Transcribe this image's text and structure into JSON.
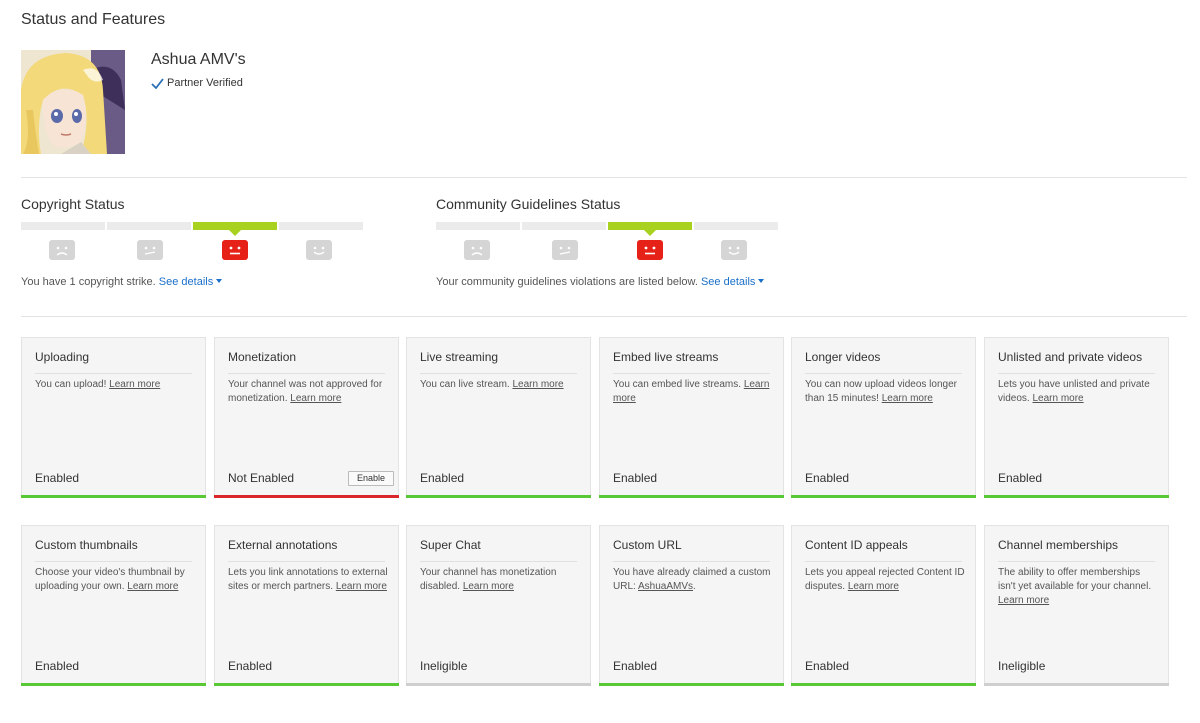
{
  "page": {
    "title": "Status and Features"
  },
  "channel": {
    "name": "Ashua AMV's",
    "verified_label": "Partner Verified"
  },
  "copyright": {
    "title": "Copyright Status",
    "active_segment": 2,
    "note": "You have 1 copyright strike.",
    "details_label": "See details"
  },
  "community": {
    "title": "Community Guidelines Status",
    "active_segment": 2,
    "note": "Your community guidelines violations are listed below.",
    "details_label": "See details"
  },
  "colors": {
    "accent_green": "#58c935",
    "meter_green": "#a8d120",
    "strike_red": "#e62117",
    "not_enabled_red": "#d9262a",
    "link_blue": "#1a6fc9"
  },
  "features": [
    {
      "title": "Uploading",
      "desc": "You can upload! ",
      "link": "Learn more",
      "status": "Enabled",
      "state": "green"
    },
    {
      "title": "Monetization",
      "desc": "Your channel was not approved for monetization. ",
      "link": "Learn more",
      "status": "Not Enabled",
      "state": "red",
      "action": "Enable"
    },
    {
      "title": "Live streaming",
      "desc": "You can live stream. ",
      "link": "Learn more",
      "status": "Enabled",
      "state": "green"
    },
    {
      "title": "Embed live streams",
      "desc": "You can embed live streams. ",
      "link": "Learn more",
      "status": "Enabled",
      "state": "green"
    },
    {
      "title": "Longer videos",
      "desc": "You can now upload videos longer than 15 minutes! ",
      "link": "Learn more",
      "status": "Enabled",
      "state": "green"
    },
    {
      "title": "Unlisted and private videos",
      "desc": "Lets you have unlisted and private videos. ",
      "link": "Learn more",
      "status": "Enabled",
      "state": "green"
    },
    {
      "title": "Custom thumbnails",
      "desc": "Choose your video's thumbnail by uploading your own. ",
      "link": "Learn more",
      "status": "Enabled",
      "state": "green"
    },
    {
      "title": "External annotations",
      "desc": "Lets you link annotations to external sites or merch partners. ",
      "link": "Learn more",
      "status": "Enabled",
      "state": "green"
    },
    {
      "title": "Super Chat",
      "desc": "Your channel has monetization disabled. ",
      "link": "Learn more",
      "status": "Ineligible",
      "state": "grey"
    },
    {
      "title": "Custom URL",
      "desc": "You have already claimed a custom URL: ",
      "link": "AshuaAMVs",
      "suffix": ".",
      "status": "Enabled",
      "state": "green"
    },
    {
      "title": "Content ID appeals",
      "desc": "Lets you appeal rejected Content ID disputes. ",
      "link": "Learn more",
      "status": "Enabled",
      "state": "green"
    },
    {
      "title": "Channel memberships",
      "desc": "The ability to offer memberships isn't yet available for your channel. ",
      "link": "Learn more",
      "status": "Ineligible",
      "state": "grey"
    }
  ]
}
